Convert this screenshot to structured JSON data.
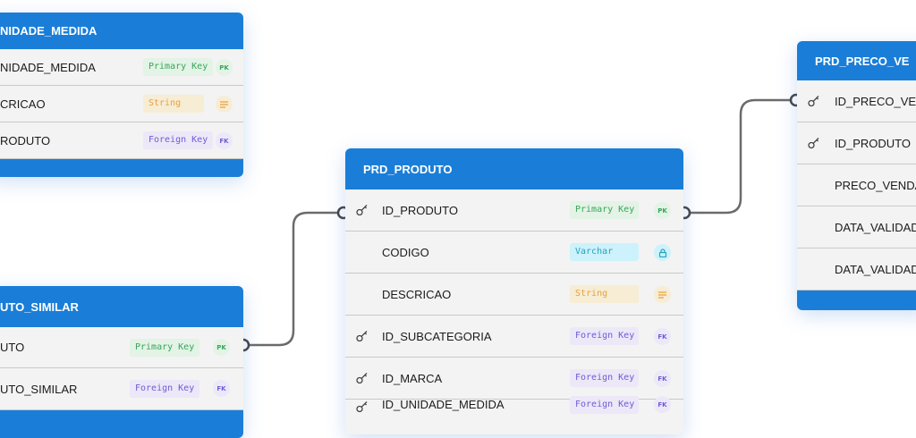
{
  "colors": {
    "header": "#1a7ed8",
    "row_bg": "#f3f3f3",
    "primary_key": "#39a55a",
    "foreign_key": "#6c5cd6",
    "string": "#e7a23b",
    "varchar": "#21a4bd",
    "connector": "#6b6b6b"
  },
  "tables": {
    "unidade": {
      "title": "NIDADE_MEDIDA",
      "rows": [
        {
          "name": "NIDADE_MEDIDA",
          "type": "Primary Key",
          "icon": "PK"
        },
        {
          "name": "CRICAO",
          "type": "String",
          "icon": "text-lines-icon"
        },
        {
          "name": "RODUTO",
          "type": "Foreign Key",
          "icon": "FK"
        }
      ]
    },
    "similar": {
      "title": "UTO_SIMILAR",
      "rows": [
        {
          "name": "UTO",
          "type": "Primary Key",
          "icon": "PK"
        },
        {
          "name": "UTO_SIMILAR",
          "type": "Foreign Key",
          "icon": "FK"
        }
      ]
    },
    "produto": {
      "title": "PRD_PRODUTO",
      "rows": [
        {
          "name": "ID_PRODUTO",
          "type": "Primary Key",
          "icon": "PK",
          "key_icon": "key-icon"
        },
        {
          "name": "CODIGO",
          "type": "Varchar",
          "icon": "lock-icon"
        },
        {
          "name": "DESCRICAO",
          "type": "String",
          "icon": "text-lines-icon"
        },
        {
          "name": "ID_SUBCATEGORIA",
          "type": "Foreign Key",
          "icon": "FK",
          "key_icon": "key-icon"
        },
        {
          "name": "ID_MARCA",
          "type": "Foreign Key",
          "icon": "FK",
          "key_icon": "key-icon"
        },
        {
          "name": "ID_UNIDADE_MEDIDA",
          "type": "Foreign Key",
          "icon": "FK",
          "key_icon": "key-icon"
        }
      ]
    },
    "preco": {
      "title": "PRD_PRECO_VE",
      "rows": [
        {
          "name": "ID_PRECO_VEN",
          "key_icon": "key-icon"
        },
        {
          "name": "ID_PRODUTO",
          "key_icon": "key-icon"
        },
        {
          "name": "PRECO_VENDA"
        },
        {
          "name": "DATA_VALIDAD"
        },
        {
          "name": "DATA_VALIDAD"
        }
      ]
    }
  }
}
